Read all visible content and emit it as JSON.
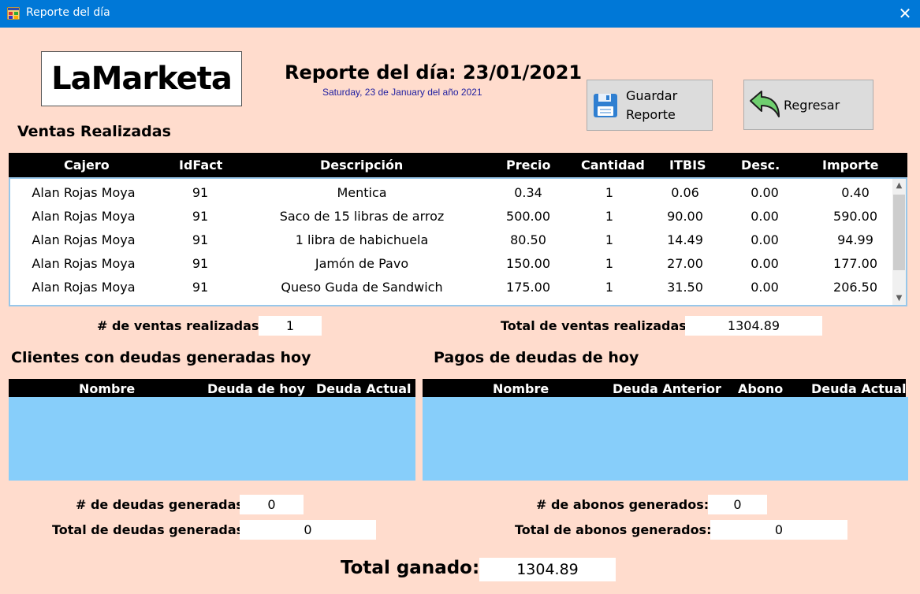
{
  "window": {
    "title": "Reporte del día",
    "app_icon": "winforms-app-icon",
    "close_icon": "close-icon"
  },
  "logo": {
    "text": "LaMarketa"
  },
  "report": {
    "title": "Reporte del día: 23/01/2021",
    "date_long": "Saturday, 23 de January del año 2021"
  },
  "buttons": {
    "save": {
      "label": "Guardar Reporte",
      "icon": "floppy-disk-icon"
    },
    "back": {
      "label": "Regresar",
      "icon": "undo-arrow-icon"
    }
  },
  "sales": {
    "section_title": "Ventas Realizadas",
    "columns": [
      "Cajero",
      "IdFact",
      "Descripción",
      "Precio",
      "Cantidad",
      "ITBIS",
      "Desc.",
      "Importe"
    ],
    "rows": [
      [
        "Alan Rojas Moya",
        "91",
        "Mentica",
        "0.34",
        "1",
        "0.06",
        "0.00",
        "0.40"
      ],
      [
        "Alan Rojas Moya",
        "91",
        "Saco de 15 libras de arroz",
        "500.00",
        "1",
        "90.00",
        "0.00",
        "590.00"
      ],
      [
        "Alan Rojas Moya",
        "91",
        "1 libra de habichuela",
        "80.50",
        "1",
        "14.49",
        "0.00",
        "94.99"
      ],
      [
        "Alan Rojas Moya",
        "91",
        "Jamón de Pavo",
        "150.00",
        "1",
        "27.00",
        "0.00",
        "177.00"
      ],
      [
        "Alan Rojas Moya",
        "91",
        "Queso Guda de Sandwich",
        "175.00",
        "1",
        "31.50",
        "0.00",
        "206.50"
      ]
    ],
    "count_label": "# de ventas realizadas:",
    "count_value": "1",
    "total_label": "Total de ventas realizadas:",
    "total_value": "1304.89"
  },
  "debts": {
    "section_title": "Clientes con deudas generadas hoy",
    "columns": [
      "Nombre",
      "Deuda de hoy",
      "Deuda Actual"
    ],
    "count_label": "# de deudas generadas:",
    "count_value": "0",
    "total_label": "Total de deudas generadas:",
    "total_value": "0"
  },
  "payments": {
    "section_title": "Pagos de deudas de hoy",
    "columns": [
      "Nombre",
      "Deuda Anterior",
      "Abono",
      "Deuda Actual"
    ],
    "count_label": "# de abonos generados:",
    "count_value": "0",
    "total_label": "Total de abonos generados:",
    "total_value": "0"
  },
  "grand_total": {
    "label": "Total ganado:",
    "value": "1304.89"
  }
}
